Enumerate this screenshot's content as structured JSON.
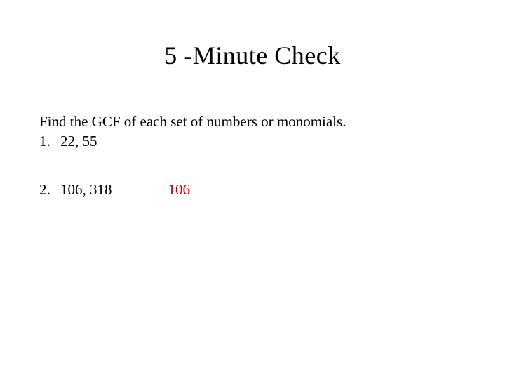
{
  "title": "5 -Minute Check",
  "instruction": "Find the GCF of each set of numbers or monomials.",
  "problems": [
    {
      "number": "1.",
      "text": "22, 55",
      "answer": ""
    },
    {
      "number": "2.",
      "text": "106, 318",
      "answer": "106"
    }
  ]
}
